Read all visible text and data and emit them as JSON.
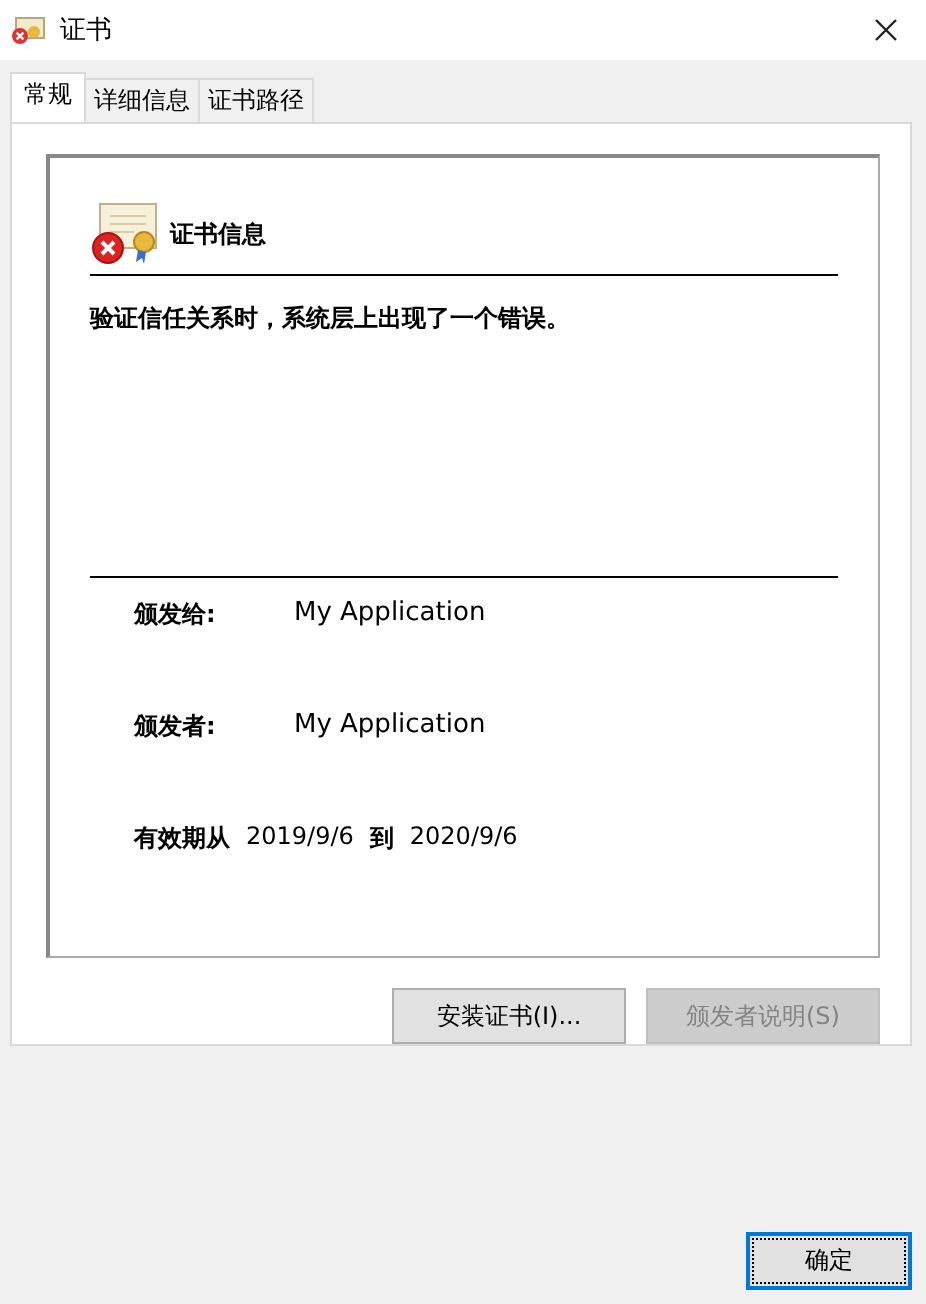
{
  "window": {
    "title": "证书"
  },
  "tabs": [
    {
      "label": "常规",
      "selected": true
    },
    {
      "label": "详细信息",
      "selected": false
    },
    {
      "label": "证书路径",
      "selected": false
    }
  ],
  "cert_info": {
    "heading": "证书信息",
    "message": "验证信任关系时，系统层上出现了一个错误。"
  },
  "fields": [
    {
      "label": "颁发给:",
      "value": "My Application"
    },
    {
      "label": "颁发者:",
      "value": "My Application"
    }
  ],
  "validity": {
    "label": "有效期从",
    "from": "2019/9/6",
    "to_label": "到",
    "to": "2020/9/6"
  },
  "buttons": [
    {
      "label": "安装证书(I)...",
      "disabled": false
    },
    {
      "label": "颁发者说明(S)",
      "disabled": true
    }
  ],
  "ok_button": {
    "label": "确定"
  }
}
